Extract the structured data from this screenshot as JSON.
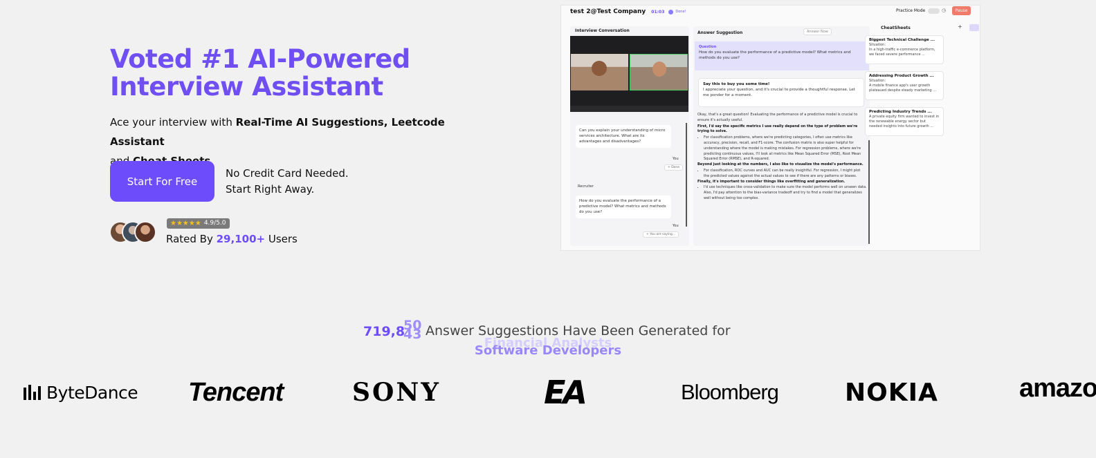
{
  "hero": {
    "title_line1": "Voted #1 AI-Powered",
    "title_line2": "Interview Assistant",
    "sub_prefix": "Ace your interview with ",
    "sub_bold1": "Real-Time AI Suggestions, Leetcode Assistant",
    "sub_and": "and ",
    "sub_bold2": "Cheat Sheets",
    "cta_label": "Start For Free",
    "note_line1": "No Credit Card Needed.",
    "note_line2": "Start Right Away.",
    "rating_stars": "★★★★★",
    "rating_value": "4.9/5.0",
    "rated_prefix": "Rated By ",
    "rated_count": "29,100+",
    "rated_suffix": " Users"
  },
  "screenshot": {
    "company": "test 2@Test Company",
    "timer": "01:03",
    "done": "Done!",
    "practice_mode": "Practice Mode",
    "pause": "Pause",
    "conversation_title": "Interview Conversation",
    "bubble1": "Can you explain your understanding of micro services architecture. What are its advantages and disadvantages?",
    "you_label": "You",
    "done_btn": "+ Done",
    "recruiter_label": "Recruiter",
    "bubble2": "How do you evaluate the performance of a predictive model? What metrics and methods do you use?",
    "typing": "+ You are saying...",
    "answer_title": "Answer Suggestion",
    "answer_now": "Answer Now",
    "question_label": "Question",
    "question_text": "How do you evaluate the performance of a predictive model? What metrics and methods do you use?",
    "say_title": "Say this to buy you some time!",
    "say_text": "I appreciate your question, and it's crucial to provide a thoughtful response. Let me ponder for a moment.",
    "ans_p1": "Okay, that's a great question! Evaluating the performance of a predictive model is crucial to ensure it's actually useful.",
    "ans_p2": "First, I'd say the specific metrics I use really depend on the type of problem we're trying to solve.",
    "ans_li1": "For classification problems, where we're predicting categories, I often use metrics like accuracy, precision, recall, and F1-score. The confusion matrix is also super helpful for understanding where the model is making mistakes. For regression problems, where we're predicting continuous values, I'll look at metrics like Mean Squared Error (MSE), Root Mean Squared Error (RMSE), and R-squared.",
    "ans_p3": "Beyond just looking at the numbers, I also like to visualize the model's performance.",
    "ans_li2": "For classification, ROC curves and AUC can be really insightful. For regression, I might plot the predicted values against the actual values to see if there are any patterns or biases.",
    "ans_p4": "Finally, it's important to consider things like overfitting and generalization.",
    "ans_li3": "I'd use techniques like cross-validation to make sure the model performs well on unseen data. Also, I'd pay attention to the bias-variance tradeoff and try to find a model that generalizes well without being too complex.",
    "cheatsheets_title": "CheatSheets",
    "card1_title": "Biggest Technical Challenge ...",
    "card1_label": "Situation:",
    "card1_text": "In a high-traffic e-commerce platform, we faced severe performance ...",
    "card2_title": "Addressing Product Growth ...",
    "card2_label": "Situation:",
    "card2_text": "A mobile finance app's user growth plateaued despite steady marketing ...",
    "card3_title": "Predicting Industry Trends ...",
    "card3_text": "A private equity firm wanted to invest in the renewable energy sector but needed insights into future growth ..."
  },
  "counter": {
    "number": "719,8",
    "roll_prev": "50",
    "roll_next": "43",
    "text": "Answer Suggestions Have Been Generated for",
    "role_prev": "Financial Analysts",
    "role": "Software Developers"
  },
  "logos": {
    "bytedance": "ByteDance",
    "tencent": "Tencent",
    "sony": "SONY",
    "ea": "EA",
    "bloomberg": "Bloomberg",
    "nokia": "NOKIA",
    "amazon": "amazon"
  },
  "colors": {
    "accent": "#6d4dfb",
    "title": "#6f4ff2",
    "background": "#f1f1f1",
    "star": "#f6c21a",
    "pause": "#f17a6a"
  }
}
